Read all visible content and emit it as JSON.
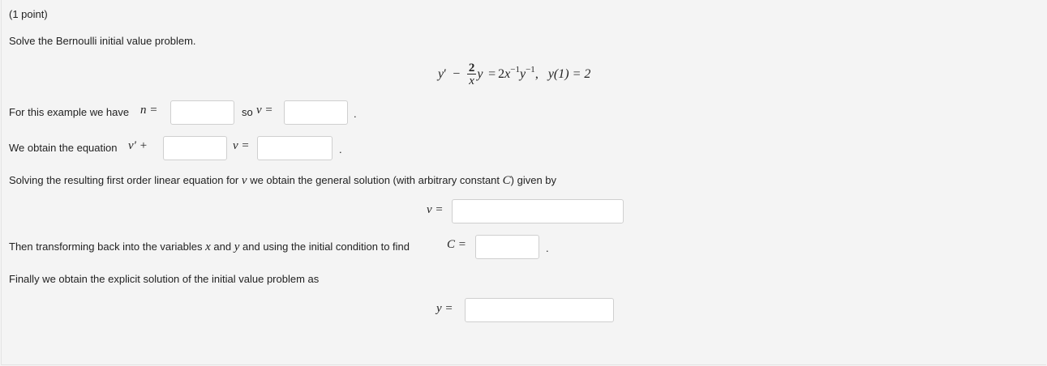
{
  "problem": {
    "points": "(1 point)",
    "prompt": "Solve the Bernoulli initial value problem."
  },
  "equation": {
    "lhs_y": "y",
    "prime": "′",
    "minus": "−",
    "frac_num": "2",
    "frac_den": "x",
    "y_after": "y",
    "equals": "=",
    "coef": "2",
    "x": "x",
    "exp1": "−1",
    "y": "y",
    "exp2": "−1",
    "comma": ",",
    "ic": "y(1) = 2"
  },
  "row_n": {
    "text": "For this example we have",
    "n_label": "n =",
    "so_label": "so",
    "v_label": "v =",
    "n_value": "",
    "v_value": "",
    "period": "."
  },
  "row_eq": {
    "text": "We obtain the equation",
    "vprime_plus": "v′ +",
    "v_eq": "v =",
    "coef_value": "",
    "rhs_value": "",
    "period": "."
  },
  "row_general": {
    "text_before": "Solving the resulting first order linear equation for",
    "v": "v",
    "text_mid": "we obtain the general solution (with arbitrary constant",
    "C": "C",
    "text_after": ") given by"
  },
  "row_v": {
    "label": "v =",
    "value": ""
  },
  "row_C": {
    "text_before": "Then transforming back into the variables",
    "x": "x",
    "and": "and",
    "y": "y",
    "text_after": "and using the initial condition to find",
    "C_label": "C =",
    "value": "",
    "period": "."
  },
  "row_final": {
    "text": "Finally we obtain the explicit solution of the initial value problem as"
  },
  "row_y": {
    "label": "y =",
    "value": ""
  }
}
